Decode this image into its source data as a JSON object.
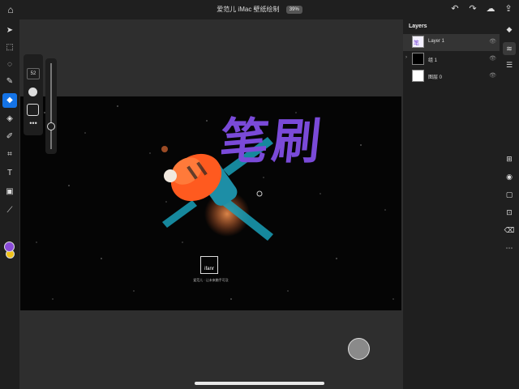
{
  "header": {
    "title": "爱范儿 iMac 壁纸绘制",
    "zoom": "39%",
    "icons": [
      "home-icon",
      "undo-icon",
      "redo-icon",
      "cloud-icon",
      "share-icon"
    ]
  },
  "tools": [
    "select-icon",
    "transform-icon",
    "lasso-icon",
    "brush-icon",
    "eraser-icon",
    "fill-icon",
    "smudge-icon",
    "crop-icon",
    "type-icon",
    "image-icon",
    "eyedropper-icon"
  ],
  "brush": {
    "size": "52",
    "more": "•••"
  },
  "colors": {
    "primary": "#8a4bd8",
    "secondary": "#f0c21a",
    "accent": "#1473e6"
  },
  "canvas": {
    "handwriting": "笔刷",
    "logo_text": "ifanr",
    "slogan": "爱范儿 · 让未来触手可及"
  },
  "layers": {
    "title": "Layers",
    "items": [
      {
        "name": "Layer 1",
        "selected": true
      },
      {
        "name": "组 1",
        "selected": false
      },
      {
        "name": "图层 0",
        "selected": false
      }
    ]
  },
  "rightbar": [
    "layers-icon",
    "layer-properties-icon",
    "adjustments-icon",
    "add-layer-icon",
    "visibility-icon",
    "mask-icon",
    "merge-icon",
    "clear-icon",
    "more-icon"
  ]
}
